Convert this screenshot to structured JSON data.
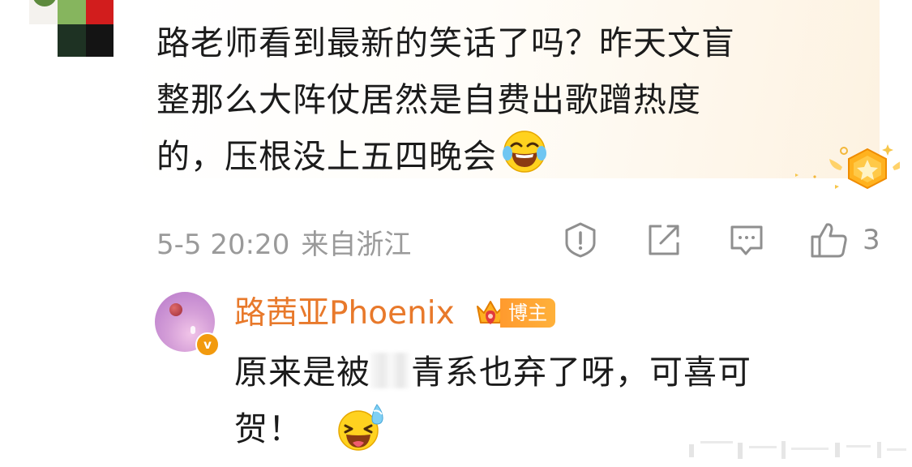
{
  "comment": {
    "text_line1": "路老师看到最新的笑话了吗？昨天文盲",
    "text_line2": "整那么大阵仗居然是自费出歌蹭热度",
    "text_line3": "的，压根没上五四晚会",
    "emoji": "laughing-tears-emoji",
    "date": "5-5 20:20",
    "location": "来自浙江",
    "like_count": "3",
    "actions": [
      "report-icon",
      "share-icon",
      "comment-icon",
      "like-icon"
    ]
  },
  "reply": {
    "author": "路茜亚Phoenix",
    "badge": "博主",
    "verified_mark": "v",
    "text_part1": "原来是被",
    "text_part2": "青系也弃了呀，可喜可",
    "text_line2": "贺！",
    "emoji": "grinning-sweat-emoji"
  },
  "colors": {
    "author_name": "#e8792b",
    "badge_bg": "#ff9a2e",
    "meta_text": "#9a9a9a",
    "body_text": "#1b1b1b"
  }
}
